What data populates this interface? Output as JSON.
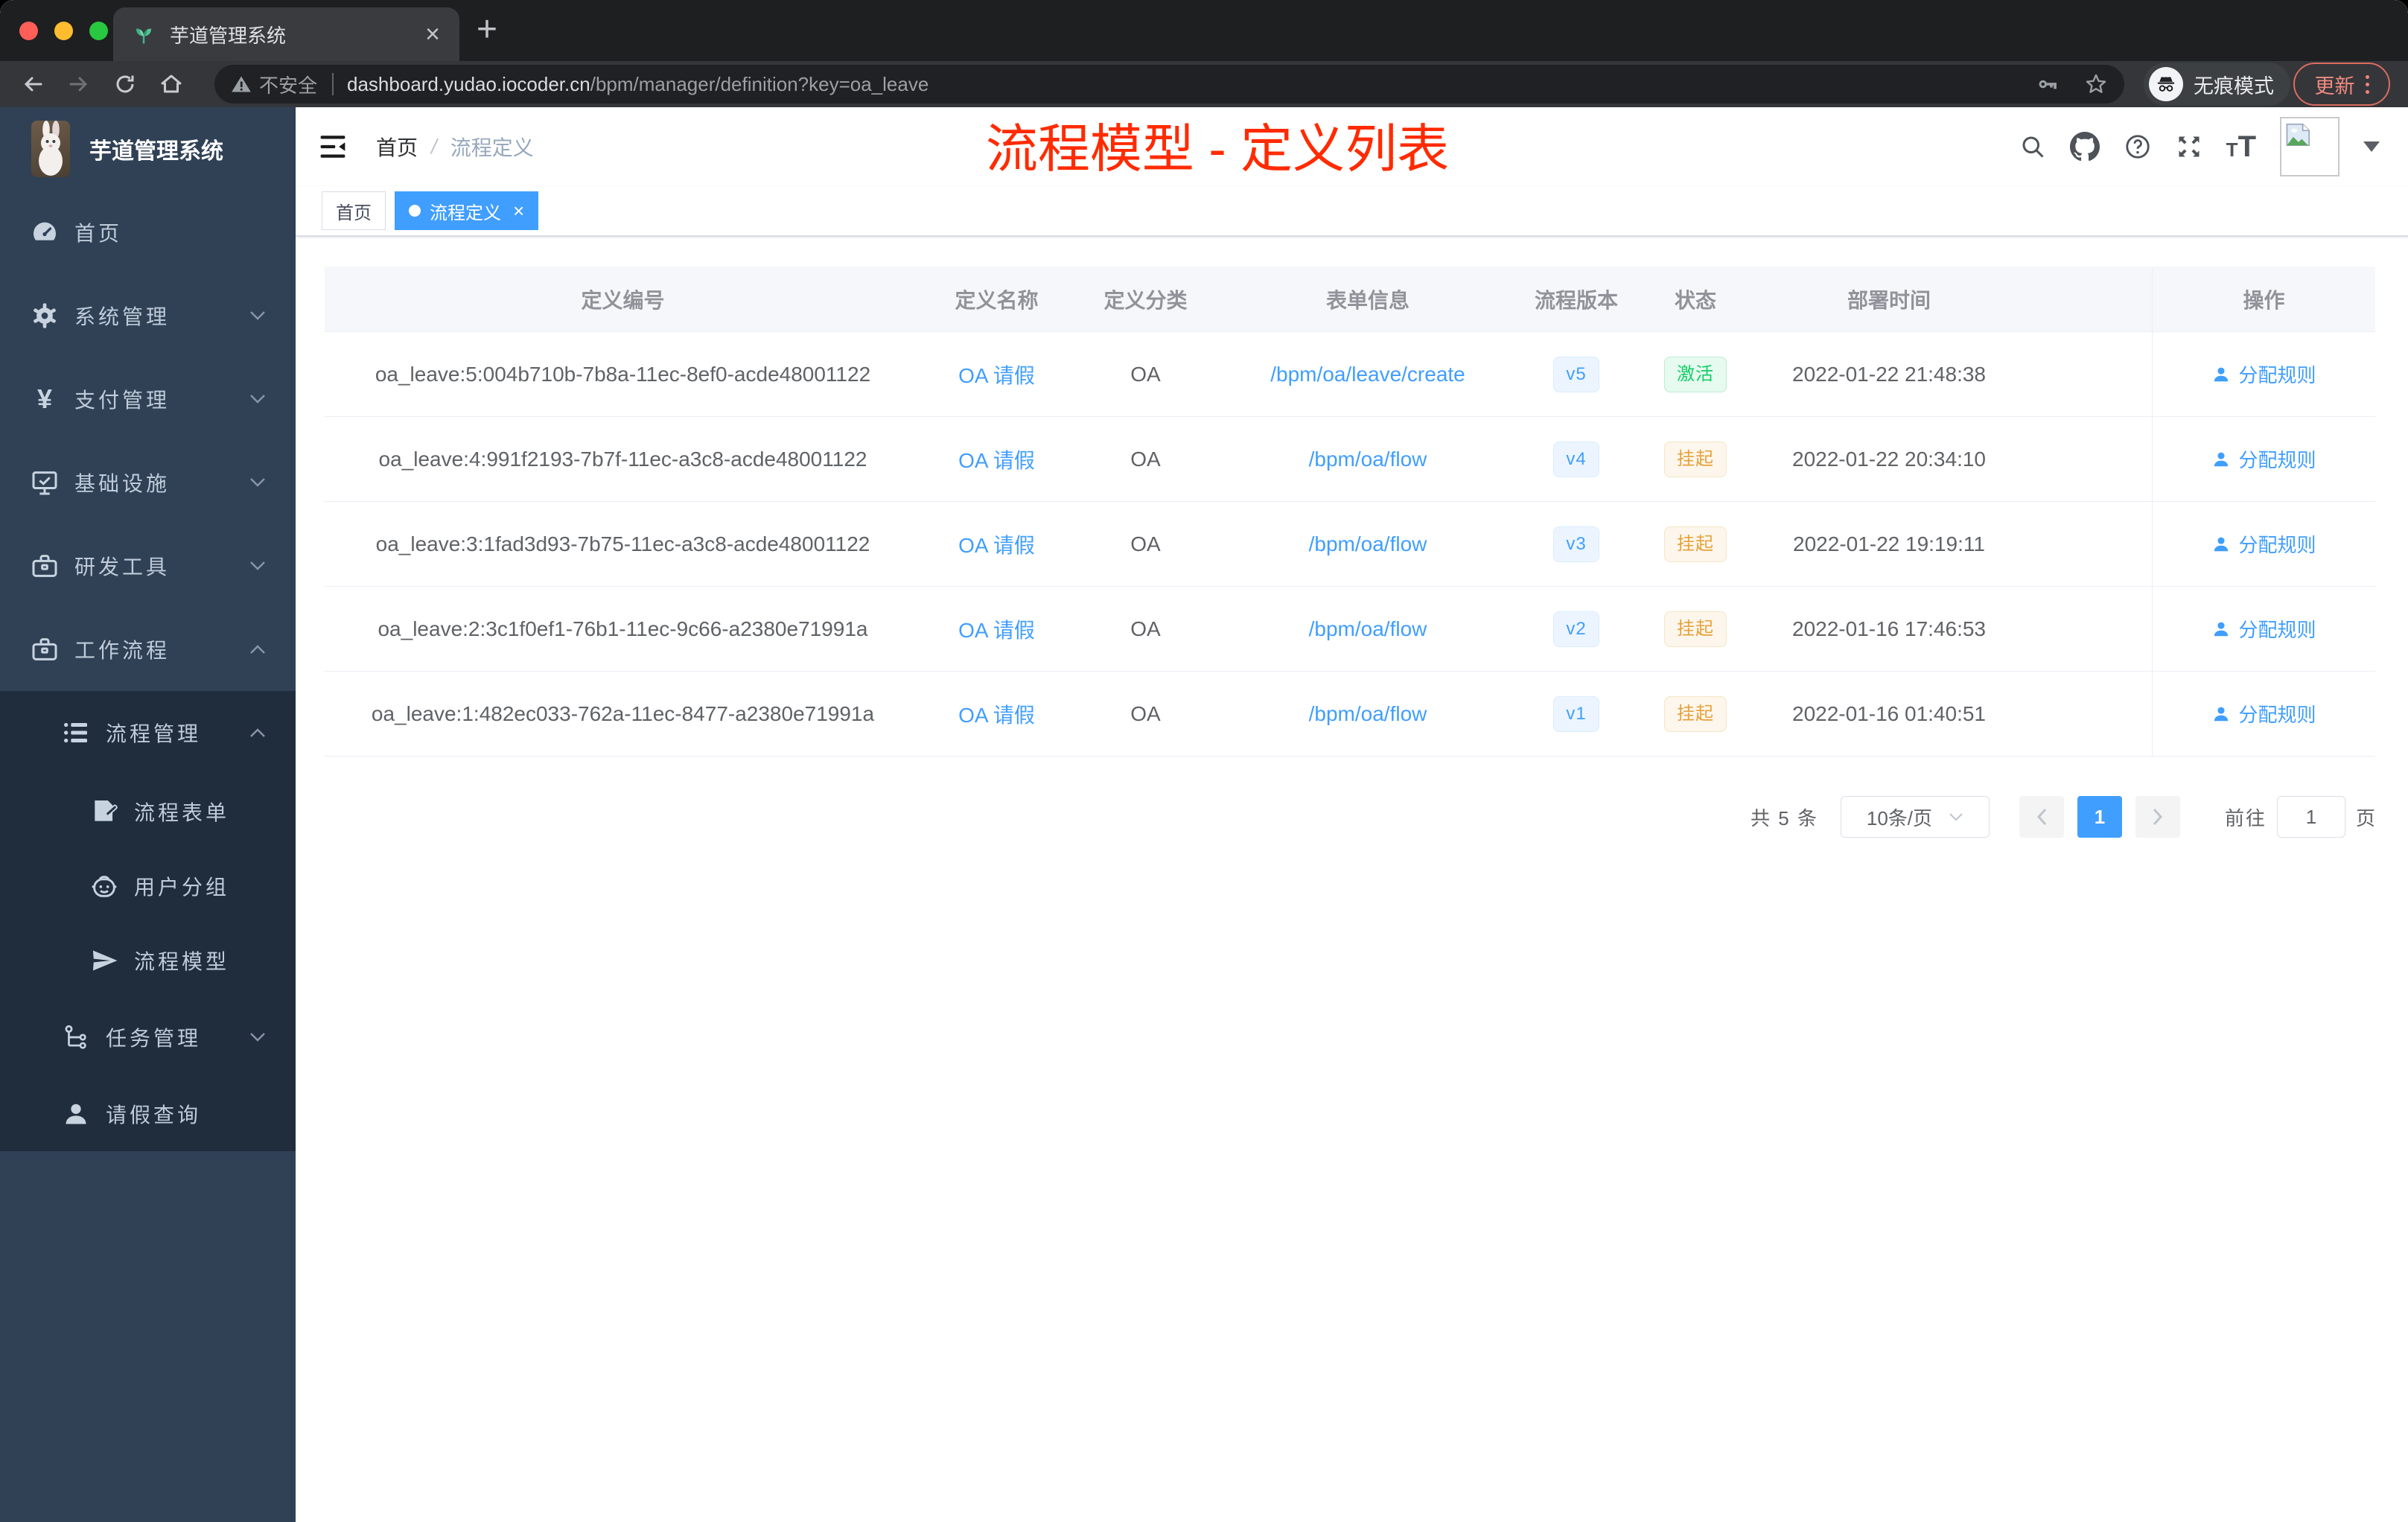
{
  "colors": {
    "accent": "#409eff",
    "success": "#13ce66",
    "warning": "#e6a23c",
    "annotation_red": "#ff2b00",
    "sidebar_bg": "#304156",
    "submenu_bg": "#1f2d3d"
  },
  "browser": {
    "tab_title": "芋道管理系统",
    "close_tab": "×",
    "new_tab": "+",
    "security_label": "不安全",
    "url_host": "dashboard.yudao.iocoder.cn",
    "url_path": "/bpm/manager/definition?key=oa_leave",
    "incognito_label": "无痕模式",
    "update_label": "更新"
  },
  "sidebar": {
    "logo_title": "芋道管理系统",
    "items": [
      {
        "label": "首页"
      },
      {
        "label": "系统管理"
      },
      {
        "label": "支付管理"
      },
      {
        "label": "基础设施"
      },
      {
        "label": "研发工具"
      },
      {
        "label": "工作流程"
      },
      {
        "label": "流程管理"
      },
      {
        "label": "流程表单"
      },
      {
        "label": "用户分组"
      },
      {
        "label": "流程模型"
      },
      {
        "label": "任务管理"
      },
      {
        "label": "请假查询"
      }
    ]
  },
  "navbar": {
    "breadcrumb_home": "首页",
    "breadcrumb_separator": "/",
    "breadcrumb_current": "流程定义"
  },
  "annotation": {
    "text": "流程模型 - 定义列表"
  },
  "tags": {
    "home": "首页",
    "active": "流程定义",
    "close": "×"
  },
  "table": {
    "columns": [
      "定义编号",
      "定义名称",
      "定义分类",
      "表单信息",
      "流程版本",
      "状态",
      "部署时间",
      "操作"
    ],
    "rows": [
      {
        "id": "oa_leave:5:004b710b-7b8a-11ec-8ef0-acde48001122",
        "name": "OA 请假",
        "category": "OA",
        "form": "/bpm/oa/leave/create",
        "version": "v5",
        "status": "激活",
        "deployed": "2022-01-22 21:48:38",
        "action": "分配规则"
      },
      {
        "id": "oa_leave:4:991f2193-7b7f-11ec-a3c8-acde48001122",
        "name": "OA 请假",
        "category": "OA",
        "form": "/bpm/oa/flow",
        "version": "v4",
        "status": "挂起",
        "deployed": "2022-01-22 20:34:10",
        "action": "分配规则"
      },
      {
        "id": "oa_leave:3:1fad3d93-7b75-11ec-a3c8-acde48001122",
        "name": "OA 请假",
        "category": "OA",
        "form": "/bpm/oa/flow",
        "version": "v3",
        "status": "挂起",
        "deployed": "2022-01-22 19:19:11",
        "action": "分配规则"
      },
      {
        "id": "oa_leave:2:3c1f0ef1-76b1-11ec-9c66-a2380e71991a",
        "name": "OA 请假",
        "category": "OA",
        "form": "/bpm/oa/flow",
        "version": "v2",
        "status": "挂起",
        "deployed": "2022-01-16 17:46:53",
        "action": "分配规则"
      },
      {
        "id": "oa_leave:1:482ec033-762a-11ec-8477-a2380e71991a",
        "name": "OA 请假",
        "category": "OA",
        "form": "/bpm/oa/flow",
        "version": "v1",
        "status": "挂起",
        "deployed": "2022-01-16 01:40:51",
        "action": "分配规则"
      }
    ]
  },
  "pagination": {
    "total": "共 5 条",
    "page_size": "10条/页",
    "page": "1",
    "goto": "前往",
    "unit": "页",
    "goto_value": "1"
  }
}
